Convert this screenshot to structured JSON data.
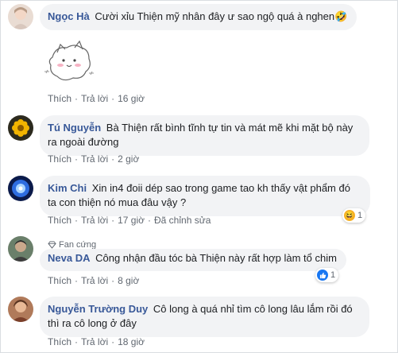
{
  "colors": {
    "name_link": "#385898",
    "bubble_bg": "#f2f3f5",
    "meta_text": "#606770",
    "like_blue": "#1877f2"
  },
  "actions": {
    "like": "Thích",
    "reply": "Trả lời",
    "separator": "·"
  },
  "comments": [
    {
      "name": "Ngọc Hà",
      "text": "Cười xỉu Thiện mỹ nhân đây ư sao ngộ quá à nghen",
      "emoji": "🤣",
      "time": "16 giờ",
      "has_sticker": true
    },
    {
      "name": "Tú Nguyễn",
      "text": "Bà Thiện rất bình tĩnh tự tin và mát mẽ khi mặt bộ này ra ngoài đường",
      "time": "2 giờ"
    },
    {
      "name": "Kim Chi",
      "text": "Xin in4 đoii dép sao trong game tao kh thấy vật phẩm đó ta con thiện nó mua đâu vậy ?",
      "time": "17 giờ",
      "edited": "Đã chỉnh sửa",
      "reaction_count": "1",
      "reaction_icon": "haha-icon"
    },
    {
      "badge": "Fan cứng",
      "name": "Neva DA",
      "text": "Công nhận đầu tóc bà Thiện này rất hợp làm tổ chim",
      "time": "8 giờ",
      "reaction_count": "1",
      "reaction_icon": "like-icon"
    },
    {
      "name": "Nguyễn Trường Duy",
      "text": "Cô long à quá nhỉ tìm cô long lâu lắm rồi đó thì ra cô long ở đây",
      "time": "18 giờ"
    }
  ]
}
